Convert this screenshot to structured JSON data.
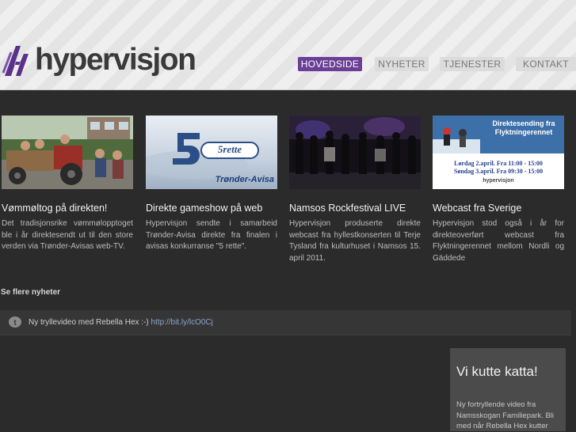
{
  "brand": {
    "logo_text": "hypervisjon"
  },
  "nav": {
    "items": [
      {
        "label": "HOVEDSIDE",
        "active": true
      },
      {
        "label": "NYHETER",
        "active": false
      },
      {
        "label": "TJENESTER",
        "active": false
      },
      {
        "label": "KONTAKT",
        "active": false
      }
    ]
  },
  "news": [
    {
      "title": "Vømmøltog på direkten!",
      "text": "Det tradisjonsrike vømmølopptoget ble i år direktesendt ut til den store verden via Trønder-Avisas web-TV."
    },
    {
      "title": "Direkte gameshow på web",
      "text": "Hypervisjon sendte i samarbeid Trønder-Avisa direkte fra finalen i avisas konkurranse \"5 rette\".",
      "thumb_logo": "5rette",
      "thumb_caption": "Trønder-Avisa"
    },
    {
      "title": "Namsos Rockfestival LIVE",
      "text": "Hypervisjon produserte direkte webcast fra hyllestkonserten til Terje Tysland fra kulturhuset i Namsos 15. april 2011."
    },
    {
      "title": "Webcast fra Sverige",
      "text": "Hypervisjon stod også i år for direkteoverført webcast fra Flyktningerennet mellom Nordli og Gäddede",
      "thumb_heading": "Direktesending fra Flyktningerennet",
      "thumb_line1": "Lørdag 2.april. Fra 11:00 - 15:00",
      "thumb_line2": "Søndag 3.april. Fra 09:30 - 15:00",
      "thumb_logo": "hypervisjon"
    }
  ],
  "more_news_label": "Se flere nyheter",
  "tweet": {
    "text": "Ny tryllevideo med Rebella Hex :-)",
    "link": "http://bit.ly/lcO0Cj"
  },
  "promo": {
    "title": "Vi kutte katta!",
    "text": "Ny fortryllende video fra Namsskogan Familiepark. Bli med når Rebella Hex kutter"
  },
  "colors": {
    "accent": "#6a3f95",
    "background": "#2b2b2b",
    "header_bg": "#e9e9e9"
  }
}
